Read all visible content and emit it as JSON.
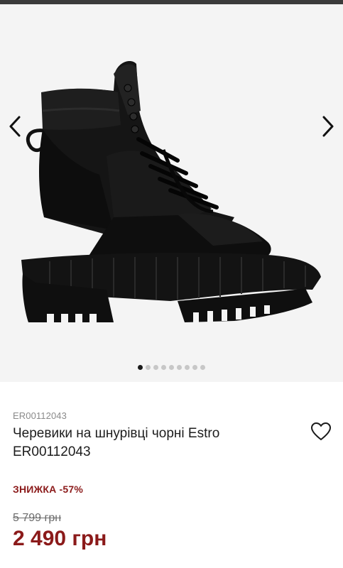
{
  "gallery": {
    "image_alt": "Черевики на шнурівці чорні Estro",
    "prev_icon": "chevron-left-icon",
    "next_icon": "chevron-right-icon",
    "slide_count": 9,
    "active_slide": 1
  },
  "product": {
    "sku": "ER00112043",
    "title": "Черевики на шнурівці чорні Estro ER00112043",
    "favorite_icon": "heart-outline-icon",
    "discount_label": "ЗНИЖКА -57%",
    "old_price": "5 799 грн",
    "new_price": "2 490 грн"
  },
  "colors": {
    "sale": "#8b1a1a",
    "muted": "#8a8a8a",
    "gallery_bg": "#f4f4f4"
  }
}
